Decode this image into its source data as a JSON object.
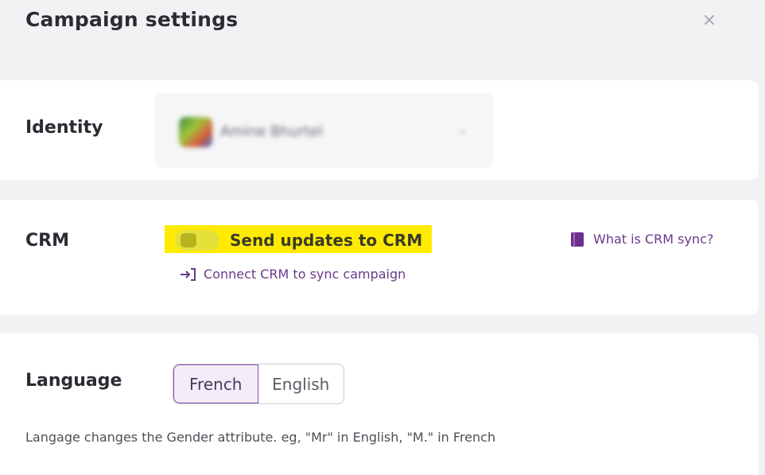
{
  "header": {
    "title": "Campaign settings",
    "close_glyph": "×"
  },
  "identity": {
    "label": "Identity",
    "selected_name": "Amine Bhurtel",
    "chevron_glyph": "⌄"
  },
  "crm": {
    "label": "CRM",
    "toggle_label": "Send updates to CRM",
    "toggle_on": false,
    "help_link": "What is CRM sync?",
    "connect_link": "Connect CRM to sync campaign",
    "highlight_color": "#ffeb00"
  },
  "language": {
    "label": "Language",
    "options": [
      "French",
      "English"
    ],
    "selected": "French",
    "note": "Langage changes the Gender attribute. eg, \"Mr\" in English, \"M.\" in French"
  },
  "colors": {
    "accent": "#6d2f8f",
    "background": "#f2f2f4"
  }
}
